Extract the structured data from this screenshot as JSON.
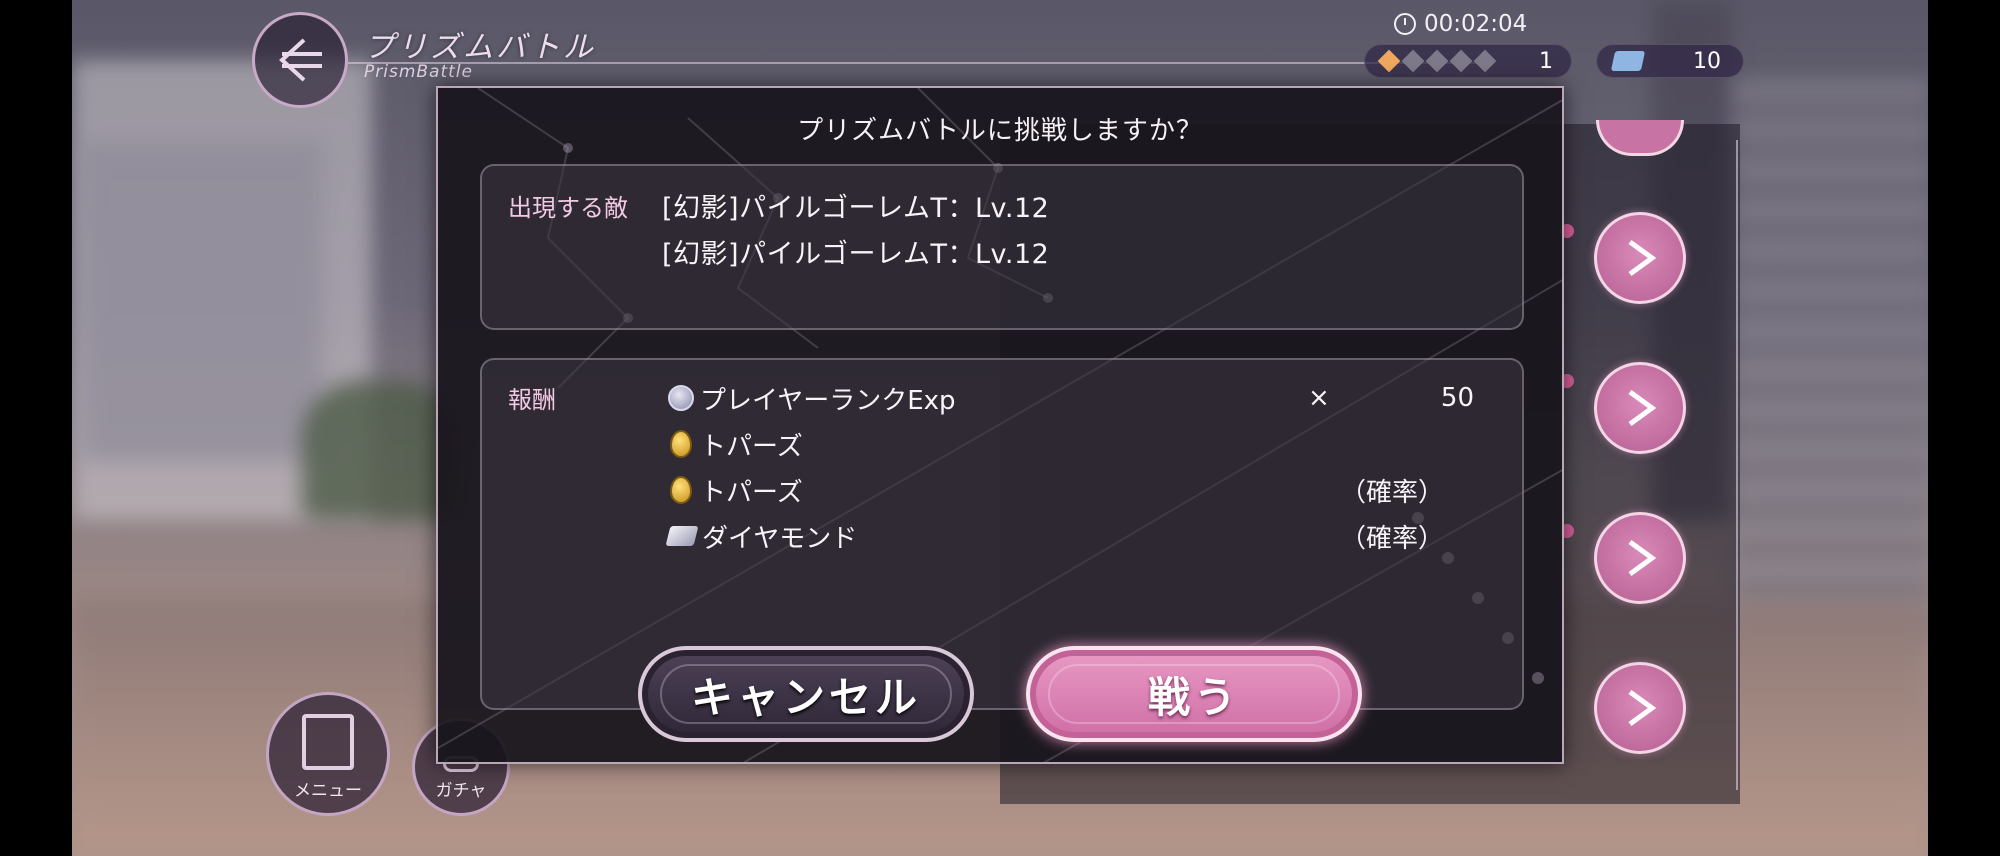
{
  "header": {
    "title": "プリズムバトル",
    "subtitle": "PrismBattle",
    "timer": "00:02:04",
    "stamina_value": "1",
    "stamina_icons": [
      "diamond-lit",
      "diamond",
      "diamond",
      "diamond",
      "diamond"
    ],
    "ticket_value": "10"
  },
  "dialog": {
    "title": "プリズムバトルに挑戦しますか？",
    "enemy_label": "出現する敵",
    "enemies": [
      "[幻影]パイルゴーレムT：Lv.12",
      "[幻影]パイルゴーレムT：Lv.12"
    ],
    "reward_label": "報酬",
    "rewards": [
      {
        "icon": "exp-icon",
        "name": "プレイヤーランクExp",
        "mult": "×",
        "qty": "50",
        "prob": ""
      },
      {
        "icon": "topaz-icon",
        "name": "トパーズ",
        "mult": "",
        "qty": "",
        "prob": ""
      },
      {
        "icon": "topaz-icon",
        "name": "トパーズ",
        "mult": "",
        "qty": "",
        "prob": "（確率）"
      },
      {
        "icon": "diamond-icon",
        "name": "ダイヤモンド",
        "mult": "",
        "qty": "",
        "prob": "（確率）"
      }
    ],
    "cancel_label": "キャンセル",
    "fight_label": "戦う"
  },
  "menu": {
    "menu_label": "メニュー",
    "gacha_label": "ガチャ"
  },
  "colors": {
    "accent_pink": "#d87aae",
    "label_pink": "#f1c9e2",
    "dialog_bg": "#18141c"
  }
}
